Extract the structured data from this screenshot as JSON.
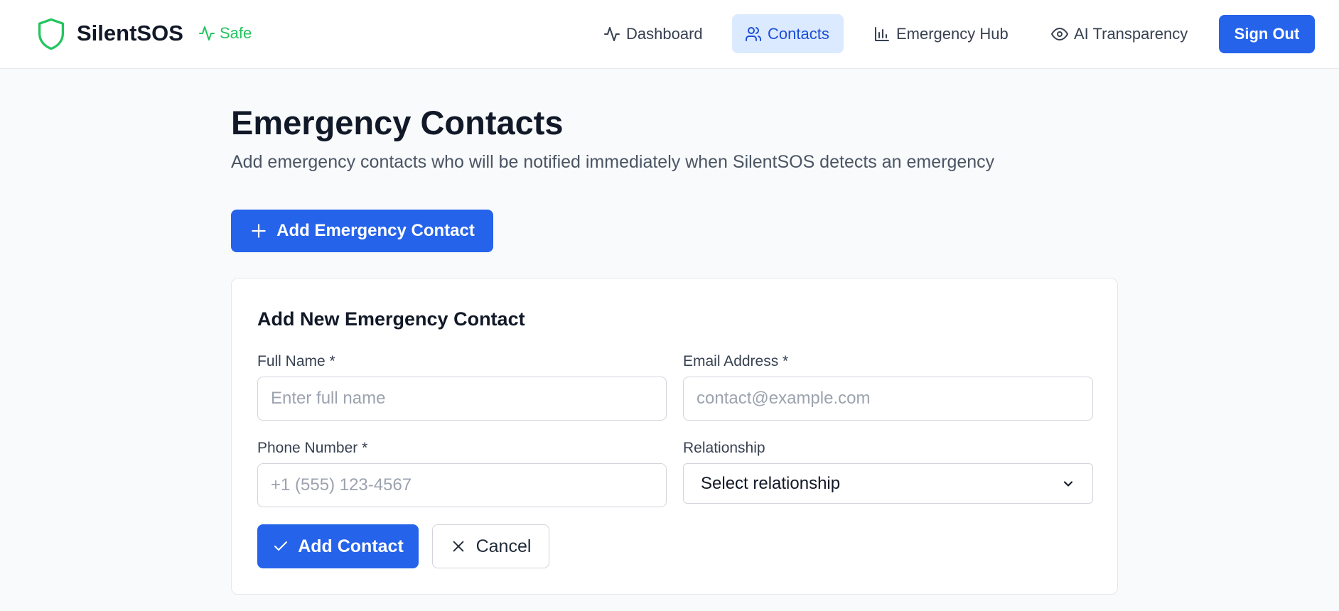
{
  "header": {
    "brand_name": "SilentSOS",
    "status_label": "Safe",
    "nav": [
      {
        "label": "Dashboard",
        "icon": "activity-icon"
      },
      {
        "label": "Contacts",
        "icon": "users-icon",
        "active": true
      },
      {
        "label": "Emergency Hub",
        "icon": "bar-chart-icon"
      },
      {
        "label": "AI Transparency",
        "icon": "eye-icon"
      }
    ],
    "sign_out_label": "Sign Out"
  },
  "main": {
    "title": "Emergency Contacts",
    "subtitle": "Add emergency contacts who will be notified immediately when SilentSOS detects an emergency",
    "add_button_label": "Add Emergency Contact"
  },
  "form": {
    "title": "Add New Emergency Contact",
    "full_name": {
      "label": "Full Name *",
      "placeholder": "Enter full name",
      "value": ""
    },
    "email": {
      "label": "Email Address *",
      "placeholder": "contact@example.com",
      "value": ""
    },
    "phone": {
      "label": "Phone Number *",
      "placeholder": "+1 (555) 123-4567",
      "value": ""
    },
    "relationship": {
      "label": "Relationship",
      "selected": "Select relationship"
    },
    "submit_label": "Add Contact",
    "cancel_label": "Cancel"
  },
  "colors": {
    "accent": "#2563eb",
    "accent_light": "#dbeafe",
    "safe_green": "#22c55e",
    "background": "#f8fafc"
  }
}
